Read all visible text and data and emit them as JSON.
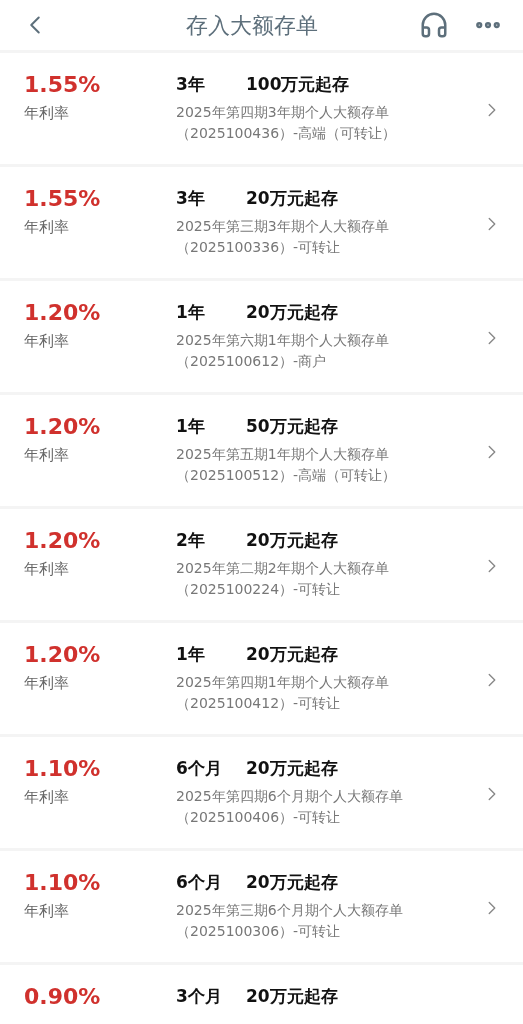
{
  "header": {
    "title": "存入大额存单"
  },
  "products": [
    {
      "rate": "1.55%",
      "rate_label": "年利率",
      "term": "3年",
      "minimum": "100万元起存",
      "name": "2025年第四期3年期个人大额存单",
      "code": "（2025100436）-高端（可转让）"
    },
    {
      "rate": "1.55%",
      "rate_label": "年利率",
      "term": "3年",
      "minimum": "20万元起存",
      "name": "2025年第三期3年期个人大额存单",
      "code": "（2025100336）-可转让"
    },
    {
      "rate": "1.20%",
      "rate_label": "年利率",
      "term": "1年",
      "minimum": "20万元起存",
      "name": "2025年第六期1年期个人大额存单",
      "code": "（2025100612）-商户"
    },
    {
      "rate": "1.20%",
      "rate_label": "年利率",
      "term": "1年",
      "minimum": "50万元起存",
      "name": "2025年第五期1年期个人大额存单",
      "code": "（2025100512）-高端（可转让）"
    },
    {
      "rate": "1.20%",
      "rate_label": "年利率",
      "term": "2年",
      "minimum": "20万元起存",
      "name": "2025年第二期2年期个人大额存单",
      "code": "（2025100224）-可转让"
    },
    {
      "rate": "1.20%",
      "rate_label": "年利率",
      "term": "1年",
      "minimum": "20万元起存",
      "name": "2025年第四期1年期个人大额存单",
      "code": "（2025100412）-可转让"
    },
    {
      "rate": "1.10%",
      "rate_label": "年利率",
      "term": "6个月",
      "minimum": "20万元起存",
      "name": "2025年第四期6个月期个人大额存单",
      "code": "（2025100406）-可转让"
    },
    {
      "rate": "1.10%",
      "rate_label": "年利率",
      "term": "6个月",
      "minimum": "20万元起存",
      "name": "2025年第三期6个月期个人大额存单",
      "code": "（2025100306）-可转让"
    },
    {
      "rate": "0.90%",
      "term": "3个月",
      "minimum": "20万元起存"
    }
  ]
}
